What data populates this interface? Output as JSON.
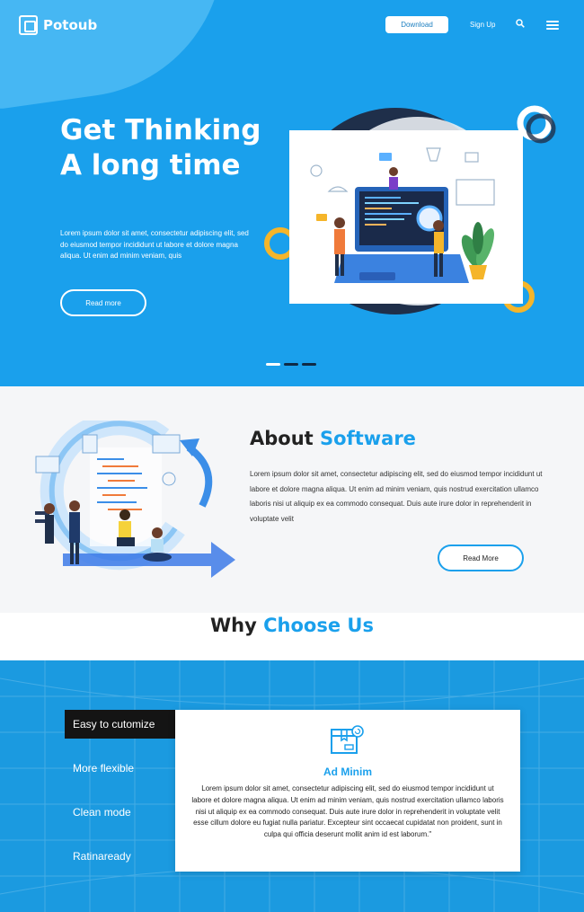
{
  "colors": {
    "primary": "#1aa0ec",
    "dark": "#141414",
    "section_bg": "#f5f6f8"
  },
  "header": {
    "logo_text": "Potoub",
    "download_label": "Download",
    "signup_label": "Sign Up",
    "search_icon": "search-icon",
    "menu_icon": "hamburger-icon"
  },
  "hero": {
    "title": "Get Thinking A long time",
    "text": "Lorem ipsum dolor sit amet, consectetur adipiscing elit, sed do eiusmod tempor incididunt ut labore et dolore magna aliqua. Ut enim ad minim veniam, quis",
    "button_label": "Read more",
    "slides": 3,
    "active_slide": 1
  },
  "about": {
    "title_plain": "About",
    "title_accent": "Software",
    "text": "Lorem ipsum dolor sit amet, consectetur adipiscing elit, sed do eiusmod tempor incididunt ut labore et dolore magna aliqua. Ut enim ad minim veniam, quis nostrud exercitation ullamco laboris nisi ut aliquip ex ea commodo consequat. Duis aute irure dolor in reprehenderit in voluptate velit",
    "button_label": "Read More"
  },
  "why": {
    "title_plain": "Why",
    "title_accent": "Choose Us"
  },
  "features": {
    "tabs": [
      {
        "label": "Easy to cutomize",
        "active": true
      },
      {
        "label": "More flexible",
        "active": false
      },
      {
        "label": "Clean mode",
        "active": false
      },
      {
        "label": "Ratinaready",
        "active": false
      }
    ],
    "card": {
      "icon": "box-refresh-icon",
      "title": "Ad Minim",
      "text": "Lorem ipsum dolor sit amet, consectetur adipiscing elit, sed do eiusmod tempor incididunt ut labore et dolore magna aliqua. Ut enim ad minim veniam, quis nostrud exercitation ullamco laboris nisi ut aliquip ex ea commodo consequat. Duis aute irure dolor in reprehenderit in voluptate velit esse cillum dolore eu fugiat nulla pariatur. Excepteur sint occaecat cupidatat non proident, sunt in culpa qui officia deserunt mollit anim id est laborum.\""
    }
  }
}
